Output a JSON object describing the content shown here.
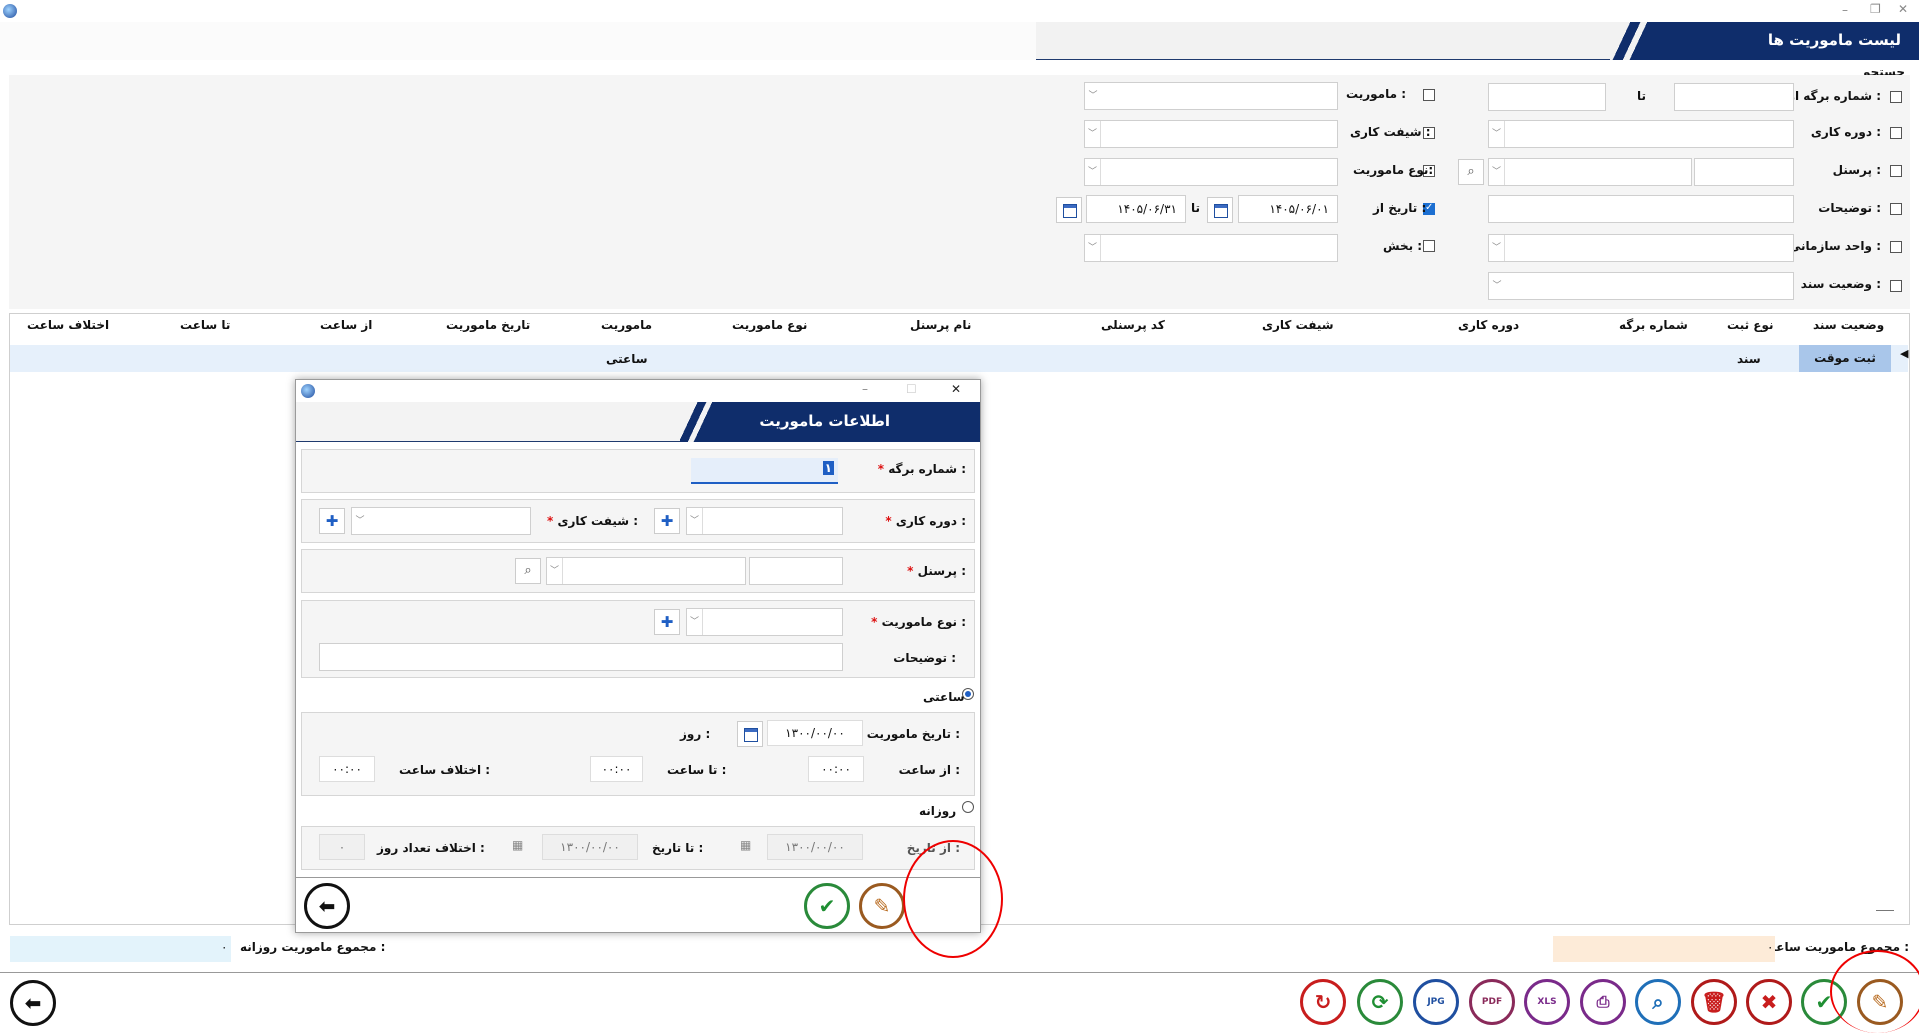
{
  "window": {
    "title": "لیست ماموریت ها",
    "search_label": "جستجو"
  },
  "search": {
    "sheet_from_label": "شماره برگه از :",
    "sheet_to_label": "تا",
    "work_period_label": "دوره کاری :",
    "personnel_label": "پرسنل :",
    "description_label": "توضیحات :",
    "org_unit_label": "واحد سازمانی :",
    "doc_status_label": "وضعیت سند :",
    "mission_label": "ماموریت :",
    "work_shift_label": "شیفت کاری :",
    "mission_type_label": "نوع ماموریت:",
    "date_from_label": "تاریخ از :",
    "date_to_label": "تا",
    "date_from_value": "۱۴۰۵/۰۶/۰۱",
    "date_to_value": "۱۴۰۵/۰۶/۳۱",
    "section_label": "بخش :",
    "date_checked": true
  },
  "grid": {
    "headers": [
      "وضعیت سند",
      "نوع ثبت",
      "شماره برگه",
      "دوره کاری",
      "شیفت کاری",
      "کد پرسنلی",
      "نام پرسنل",
      "نوع ماموریت",
      "ماموریت",
      "تاریخ ماموریت",
      "از ساعت",
      "تا ساعت",
      "اختلاف ساعت"
    ],
    "row": {
      "status": "ثبت موقت",
      "record_type": "سند",
      "mission": "ساعتی"
    }
  },
  "footer": {
    "hourly_total_label": "مجموع ماموریت ساعتی :",
    "hourly_total_value": "۰",
    "daily_total_label": "مجموع ماموریت روزانه :",
    "daily_total_value": "۰"
  },
  "dialog": {
    "title": "اطلاعات ماموریت",
    "sheet_no_label": "شماره برگه :",
    "sheet_no_value": "۱",
    "work_period_label": "دوره کاری :",
    "work_shift_label": "شیفت کاری :",
    "personnel_label": "پرسنل :",
    "mission_type_label": "نوع ماموریت :",
    "description_label": "توضیحات :",
    "hourly_label": "ساعتی",
    "mission_date_label": "تاریخ ماموریت :",
    "mission_date_value": "۱۳۰۰/۰۰/۰۰",
    "day_label": "روز :",
    "from_time_label": "از ساعت :",
    "from_time_value": "۰۰:۰۰",
    "to_time_label": "تا ساعت :",
    "to_time_value": "۰۰:۰۰",
    "time_diff_label": "اختلاف ساعت :",
    "time_diff_value": "۰۰:۰۰",
    "daily_label": "روزانه",
    "from_date_label": "از تاریخ :",
    "from_date_value": "۱۳۰۰/۰۰/۰۰",
    "to_date_label": "تا تاریخ :",
    "to_date_value": "۱۳۰۰/۰۰/۰۰",
    "day_diff_label": "اختلاف تعداد روز :",
    "day_diff_value": "۰"
  },
  "colors": {
    "banner": "#0f2d6b",
    "selected_row": "#e6f0fb",
    "status_cell": "#a9c6ea",
    "hourly_sum_bg": "#fdebd8",
    "daily_sum_bg": "#e3f3fb",
    "highlight_circle": "#e00000"
  },
  "toolbar_icons": [
    "edit-icon",
    "confirm-icon",
    "cancel-icon",
    "delete-icon",
    "search-icon",
    "print-icon",
    "xls-icon",
    "pdf-icon",
    "jpg-icon",
    "refresh-icon",
    "reset-icon",
    "back-icon"
  ]
}
